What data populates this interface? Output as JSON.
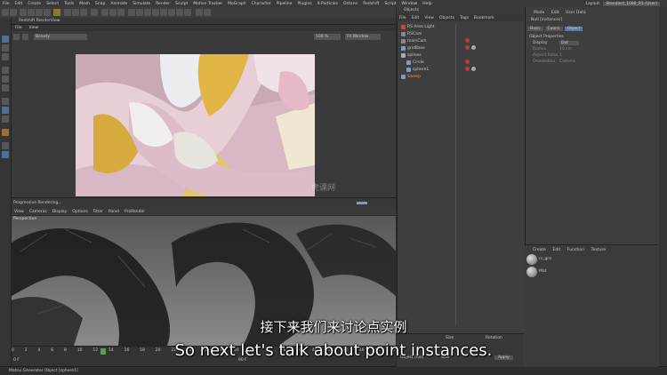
{
  "menubar": {
    "items": [
      "File",
      "Edit",
      "Create",
      "Select",
      "Tools",
      "Mesh",
      "Snap",
      "Animate",
      "Simulate",
      "Render",
      "Sculpt",
      "Motion Tracker",
      "MoGraph",
      "Character",
      "Pipeline",
      "Plugins",
      "X-Particles",
      "Octane",
      "Redshift",
      "Script",
      "Window",
      "Help"
    ],
    "layout_label": "Layout:",
    "layout_value": "Standard_1080_R5 (User)"
  },
  "render_view": {
    "title": "Redshift RenderView",
    "menu": [
      "File",
      "View"
    ],
    "beauty_label": "Beauty",
    "zoom": "100 %",
    "fit_window": "Fit Window",
    "progress_text": "Progressive Rendering..."
  },
  "viewport": {
    "menu": [
      "View",
      "Cameras",
      "Display",
      "Options",
      "Filter",
      "Panel",
      "ProRender"
    ],
    "label": "Perspective"
  },
  "timeline": {
    "ticks": [
      "0",
      "2",
      "4",
      "6",
      "8",
      "10",
      "12",
      "14",
      "16",
      "18",
      "20",
      "22",
      "24",
      "26",
      "28",
      "30",
      "32",
      "34",
      "36",
      "38",
      "40",
      "42",
      "44",
      "46",
      "48",
      "50"
    ],
    "current_frame": "0 F",
    "end_frame": "90 F"
  },
  "status_bar": {
    "text": "Matrix Generator Object [sphere1]"
  },
  "object_manager": {
    "title": "Objects",
    "menu": [
      "File",
      "Edit",
      "View",
      "Objects",
      "Tags",
      "Bookmark"
    ],
    "objects": [
      {
        "name": "RS Area Light",
        "color": "#e0e0e0"
      },
      {
        "name": "RSCam",
        "color": "#e0e0e0"
      },
      {
        "name": "mainCam",
        "color": "#e0e0e0"
      },
      {
        "name": "gridBase",
        "color": "#e0e0e0"
      },
      {
        "name": "splines",
        "color": "#e0e0e0"
      },
      {
        "name": "Circle",
        "color": "#e0e0e0"
      },
      {
        "name": "sphere1",
        "color": "#e0e0e0"
      },
      {
        "name": "Sweep",
        "color": "#f0a030"
      }
    ]
  },
  "attributes": {
    "menu": [
      "Mode",
      "Edit",
      "User Data"
    ],
    "header": "Null [instances]",
    "tabs": [
      "Basic",
      "Coord.",
      "Object"
    ],
    "section": "Object Properties",
    "props": [
      {
        "label": "Display",
        "value": "Dot"
      },
      {
        "label": "Radius",
        "value": "10 cm"
      },
      {
        "label": "Aspect Ratio",
        "value": "1"
      },
      {
        "label": "Orientation",
        "value": "Camera"
      }
    ]
  },
  "material_manager": {
    "menu": [
      "Create",
      "Edit",
      "Function",
      "Texture"
    ],
    "materials": [
      "rs_gra",
      "Mat"
    ]
  },
  "coordinates": {
    "col_size": "Size",
    "col_rotation": "Rotation",
    "x_pos": "0 cm",
    "mode": "Object (Rel)",
    "size_mode": "Size",
    "apply": "Apply"
  },
  "subtitles": {
    "chinese": "接下来我们来讨论点实例",
    "english": "So next let's talk about point instances."
  },
  "watermark": "虎课网",
  "colors": {
    "panel_bg": "#3e3e3e",
    "menubar_bg": "#3a3a3a",
    "accent_orange": "#f0a030",
    "selection_blue": "#5a78a0"
  }
}
